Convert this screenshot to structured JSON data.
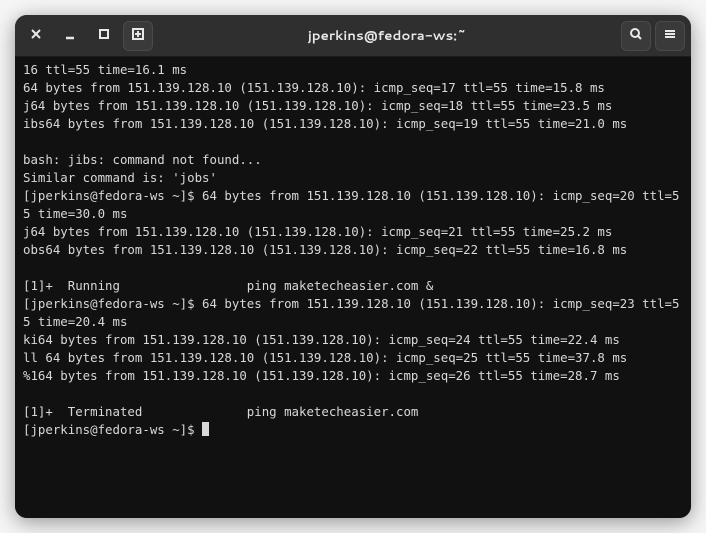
{
  "titlebar": {
    "title": "jperkins@fedora-ws:~"
  },
  "terminal": {
    "lines": [
      "16 ttl=55 time=16.1 ms",
      "64 bytes from 151.139.128.10 (151.139.128.10): icmp_seq=17 ttl=55 time=15.8 ms",
      "j64 bytes from 151.139.128.10 (151.139.128.10): icmp_seq=18 ttl=55 time=23.5 ms",
      "ibs64 bytes from 151.139.128.10 (151.139.128.10): icmp_seq=19 ttl=55 time=21.0 ms",
      "",
      "bash: jibs: command not found...",
      "Similar command is: 'jobs'",
      "[jperkins@fedora-ws ~]$ 64 bytes from 151.139.128.10 (151.139.128.10): icmp_seq=20 ttl=55 time=30.0 ms",
      "j64 bytes from 151.139.128.10 (151.139.128.10): icmp_seq=21 ttl=55 time=25.2 ms",
      "obs64 bytes from 151.139.128.10 (151.139.128.10): icmp_seq=22 ttl=55 time=16.8 ms",
      "",
      "[1]+  Running                 ping maketecheasier.com &",
      "[jperkins@fedora-ws ~]$ 64 bytes from 151.139.128.10 (151.139.128.10): icmp_seq=23 ttl=55 time=20.4 ms",
      "ki64 bytes from 151.139.128.10 (151.139.128.10): icmp_seq=24 ttl=55 time=22.4 ms",
      "ll 64 bytes from 151.139.128.10 (151.139.128.10): icmp_seq=25 ttl=55 time=37.8 ms",
      "%164 bytes from 151.139.128.10 (151.139.128.10): icmp_seq=26 ttl=55 time=28.7 ms",
      "",
      "[1]+  Terminated              ping maketecheasier.com"
    ],
    "prompt": "[jperkins@fedora-ws ~]$ "
  }
}
